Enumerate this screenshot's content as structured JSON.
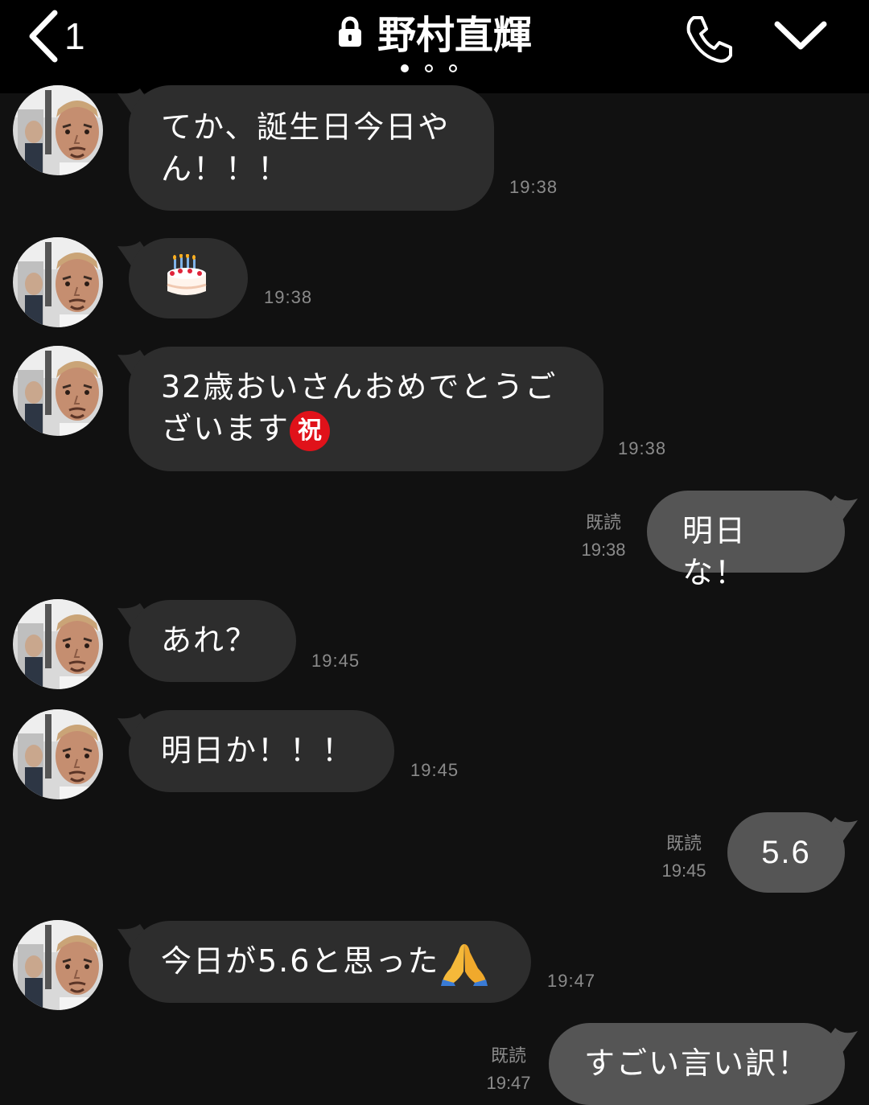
{
  "header": {
    "back_count": "1",
    "title": "野村直輝",
    "page_dots": 3,
    "active_dot": 0
  },
  "messages": [
    {
      "from": "them",
      "text": "てか、誕生日今日やん！！！",
      "line1": "てか、誕生日今日や",
      "line2": "ん！！！",
      "time": "19:38"
    },
    {
      "from": "them",
      "emoji": "birthday-cake",
      "time": "19:38"
    },
    {
      "from": "them",
      "line1": "32歳おいさんおめでとうご",
      "line2": "ざいます",
      "badge": "祝",
      "time": "19:38"
    },
    {
      "from": "me",
      "text": "明日な！",
      "read": "既読",
      "time": "19:38"
    },
    {
      "from": "them",
      "text": "あれ？",
      "time": "19:45"
    },
    {
      "from": "them",
      "text": "明日か！！！",
      "time": "19:45"
    },
    {
      "from": "me",
      "text": "5.6",
      "read": "既読",
      "time": "19:45"
    },
    {
      "from": "them",
      "text": "今日が5.6と思った",
      "emoji": "folded-hands",
      "time": "19:47"
    },
    {
      "from": "me",
      "text": "すごい言い訳！",
      "read": "既読",
      "time": "19:47"
    }
  ],
  "colors": {
    "background": "#111111",
    "header": "#000000",
    "incoming_bubble": "#2d2d2d",
    "outgoing_bubble": "#555555",
    "meta_text": "#8b8b8b",
    "badge_red": "#e0121a"
  }
}
